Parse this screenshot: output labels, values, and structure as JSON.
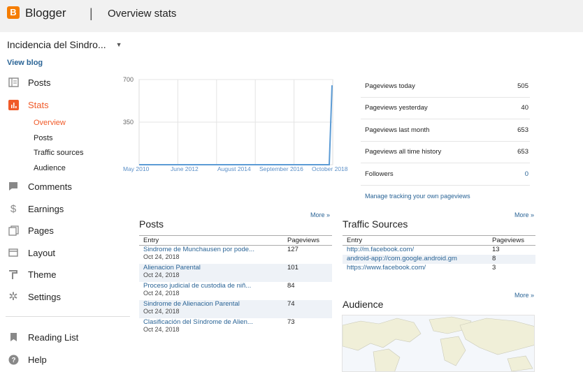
{
  "header": {
    "brand": "Blogger",
    "separator": "|",
    "title": "Overview stats",
    "logo_letter": "B"
  },
  "blog": {
    "name": "Incidencia del Sindro...",
    "view_blog": "View blog"
  },
  "nav": {
    "items": [
      {
        "label": "Posts",
        "icon": "posts-icon"
      },
      {
        "label": "Stats",
        "icon": "stats-icon"
      },
      {
        "label": "Comments",
        "icon": "comment-icon"
      },
      {
        "label": "Earnings",
        "icon": "dollar-icon"
      },
      {
        "label": "Pages",
        "icon": "pages-icon"
      },
      {
        "label": "Layout",
        "icon": "layout-icon"
      },
      {
        "label": "Theme",
        "icon": "theme-icon"
      },
      {
        "label": "Settings",
        "icon": "gear-icon"
      },
      {
        "label": "Reading List",
        "icon": "bookmark-icon"
      },
      {
        "label": "Help",
        "icon": "help-icon"
      }
    ],
    "stats_sub": [
      "Overview",
      "Posts",
      "Traffic sources",
      "Audience"
    ]
  },
  "chart_data": {
    "type": "line",
    "x_ticks": [
      "May 2010",
      "June 2012",
      "August 2014",
      "September 2016",
      "October 2018"
    ],
    "y_ticks": [
      "700",
      "350"
    ],
    "ylim": [
      0,
      700
    ],
    "series": [
      {
        "values": [
          0,
          0,
          0,
          0,
          0,
          0,
          0,
          0,
          653
        ]
      }
    ],
    "grid": true,
    "color": "#5b9bd5"
  },
  "stats": [
    {
      "label": "Pageviews today",
      "value": "505"
    },
    {
      "label": "Pageviews yesterday",
      "value": "40"
    },
    {
      "label": "Pageviews last month",
      "value": "653"
    },
    {
      "label": "Pageviews all time history",
      "value": "653"
    },
    {
      "label": "Followers",
      "value": "0"
    }
  ],
  "manage_link": "Manage tracking your own pageviews",
  "more_label": "More »",
  "posts": {
    "title": "Posts",
    "headers": [
      "Entry",
      "Pageviews"
    ],
    "rows": [
      {
        "entry": "Sindrome de Munchausen por pode...",
        "date": "Oct 24, 2018",
        "views": "127"
      },
      {
        "entry": "Alienacion Parental",
        "date": "Oct 24, 2018",
        "views": "101"
      },
      {
        "entry": "Proceso judicial de custodia de niñ...",
        "date": "Oct 24, 2018",
        "views": "84"
      },
      {
        "entry": "Sindrome de Alienacion Parental",
        "date": "Oct 24, 2018",
        "views": "74"
      },
      {
        "entry": "Clasificación del Síndrome de Alien...",
        "date": "Oct 24, 2018",
        "views": "73"
      }
    ]
  },
  "traffic": {
    "title": "Traffic Sources",
    "headers": [
      "Entry",
      "Pageviews"
    ],
    "rows": [
      {
        "entry": "http://m.facebook.com/",
        "views": "13"
      },
      {
        "entry": "android-app://com.google.android.gm",
        "views": "8"
      },
      {
        "entry": "https://www.facebook.com/",
        "views": "3"
      }
    ]
  },
  "audience": {
    "title": "Audience"
  }
}
